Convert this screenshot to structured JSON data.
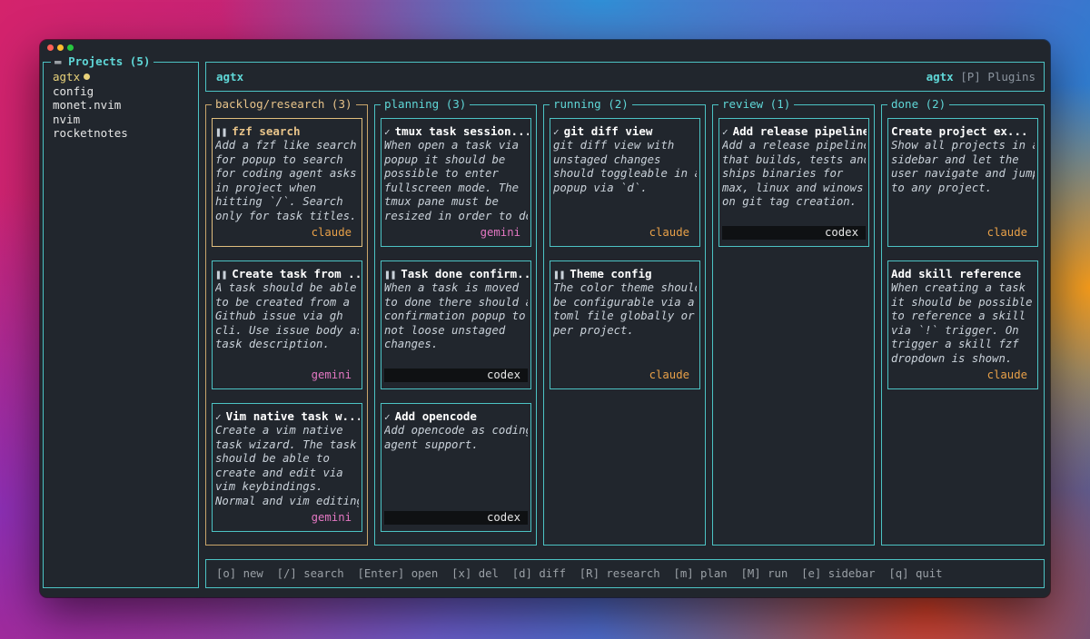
{
  "sidebar": {
    "title": "Projects (5)",
    "folder_icon": "folder-icon",
    "projects": [
      "agtx",
      "config",
      "monet.nvim",
      "nvim",
      "rocketnotes"
    ],
    "active_index": 0
  },
  "header": {
    "title": "agtx",
    "right_name": "agtx",
    "right_key": "[P]",
    "right_label": "Plugins"
  },
  "columns": [
    {
      "title": "backlog/research (3)",
      "cards": [
        {
          "status": "pause",
          "title": "fzf search",
          "desc": "Add a fzf like search\nfor popup to search\nfor coding agent asks\nin project when\nhitting `/`. Search\nonly for task titles.",
          "agent": "claude"
        },
        {
          "status": "pause",
          "title": "Create task from ...",
          "desc": "A task should be able\nto be created from a\nGithub issue via gh\ncli. Use issue body as\ntask description.",
          "agent": "gemini"
        },
        {
          "status": "check",
          "title": "Vim native task w...",
          "desc": "Create a vim native\ntask wizard. The task\nshould be able to\ncreate and edit via\nvim keybindings.\nNormal and vim editing",
          "agent": "gemini"
        }
      ]
    },
    {
      "title": "planning (3)",
      "cards": [
        {
          "status": "check",
          "title": "tmux task session...",
          "desc": "When open a task via\npopup it should be\npossible to enter\nfullscreen mode. The\ntmux pane must be\nresized in order to do",
          "agent": "gemini"
        },
        {
          "status": "pause",
          "title": "Task done confirm...",
          "desc": "When a task is moved\nto done there should a\nconfirmation popup to\nnot loose unstaged\nchanges.",
          "agent": "codex"
        },
        {
          "status": "check",
          "title": "Add opencode",
          "desc": "Add opencode as coding\nagent support.",
          "agent": "codex"
        }
      ]
    },
    {
      "title": "running (2)",
      "cards": [
        {
          "status": "check",
          "title": "git diff view",
          "desc": "git diff view with\nunstaged changes\nshould toggleable in a\npopup via `d`.",
          "agent": "claude"
        },
        {
          "status": "pause",
          "title": "Theme config",
          "desc": "The color theme should\nbe configurable via a\ntoml file globally or\nper project.",
          "agent": "claude"
        }
      ]
    },
    {
      "title": "review (1)",
      "cards": [
        {
          "status": "check",
          "title": "Add release pipeline",
          "desc": "Add a release pipeline\nthat builds, tests and\nships binaries for\nmax, linux and winows\non git tag creation.",
          "agent": "codex"
        }
      ]
    },
    {
      "title": "done (2)",
      "cards": [
        {
          "status": "",
          "title": "Create project ex...",
          "desc": "Show all projects in a\nsidebar and let the\nuser navigate and jump\nto any project.",
          "agent": "claude"
        },
        {
          "status": "",
          "title": "Add skill reference",
          "desc": "When creating a task\nit should be possible\nto reference a skill\nvia `!` trigger. On\ntrigger a skill fzf\ndropdown is shown.",
          "agent": "claude"
        }
      ]
    }
  ],
  "footer": {
    "keys": "[o] new  [/] search  [Enter] open  [x] del  [d] diff  [R] research  [m] plan  [M] run  [e] sidebar  [q] quit"
  },
  "colors": {
    "accent": "#5fd7d7",
    "selected": "#e0be7e",
    "claude": "#e8a048",
    "gemini": "#e377c2"
  }
}
